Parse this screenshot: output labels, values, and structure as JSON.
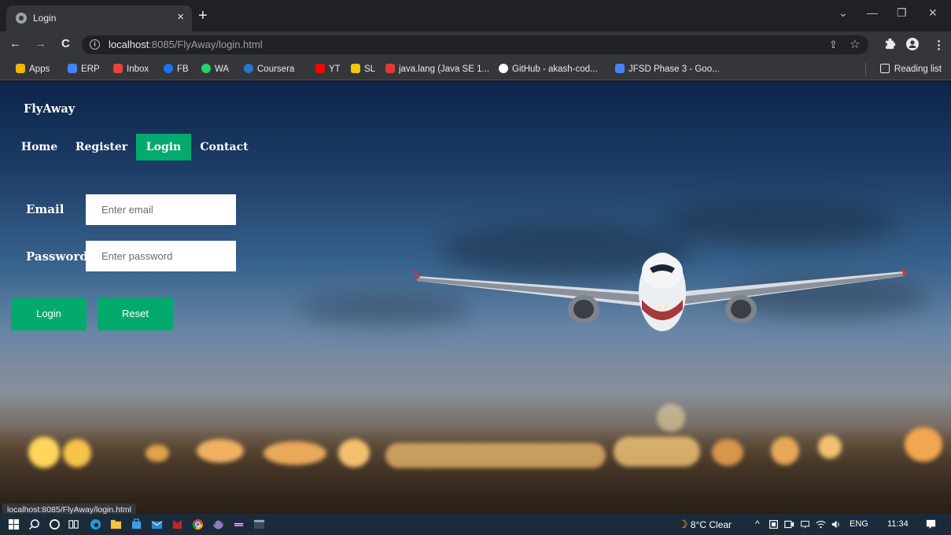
{
  "browser": {
    "tab_title": "Login",
    "tab_close": "×",
    "new_tab": "+",
    "url_host": "localhost",
    "url_path": ":8085/FlyAway/login.html",
    "nav_back": "←",
    "nav_forward": "→",
    "nav_reload": "C",
    "window_min": "—",
    "window_restore": "❐",
    "window_close": "✕",
    "window_tabsearch": "⌄",
    "star": "☆",
    "share": "⇪",
    "menu": "⋮",
    "bookmarks": [
      {
        "label": "Apps",
        "color": "#f4b400"
      },
      {
        "label": "ERP",
        "color": "#4285f4"
      },
      {
        "label": "Inbox",
        "color": "#ea4335"
      },
      {
        "label": "FB",
        "color": "#1877f2"
      },
      {
        "label": "WA",
        "color": "#25d366"
      },
      {
        "label": "Coursera",
        "color": "#2a73cc"
      },
      {
        "label": "YT",
        "color": "#ff0000"
      },
      {
        "label": "SL",
        "color": "#f2c811"
      },
      {
        "label": "java.lang (Java SE 1...",
        "color": "#e53935"
      },
      {
        "label": "GitHub - akash-cod...",
        "color": "#ffffff"
      },
      {
        "label": "JFSD Phase 3 - Goo...",
        "color": "#4285f4"
      }
    ],
    "reading_list": "Reading list",
    "status_url": "localhost:8085/FlyAway/login.html"
  },
  "page": {
    "brand": "FlyAway",
    "nav": [
      {
        "label": "Home",
        "active": false
      },
      {
        "label": "Register",
        "active": false
      },
      {
        "label": "Login",
        "active": true
      },
      {
        "label": "Contact",
        "active": false
      }
    ],
    "form": {
      "email_label": "Email",
      "email_placeholder": "Enter email",
      "email_value": "",
      "password_label": "Password",
      "password_placeholder": "Enter password",
      "password_value": "",
      "login_button": "Login",
      "reset_button": "Reset"
    },
    "accent_color": "#04aa6d"
  },
  "taskbar": {
    "weather": "8°C Clear",
    "language": "ENG",
    "time": "11:34",
    "tray_up": "^"
  }
}
